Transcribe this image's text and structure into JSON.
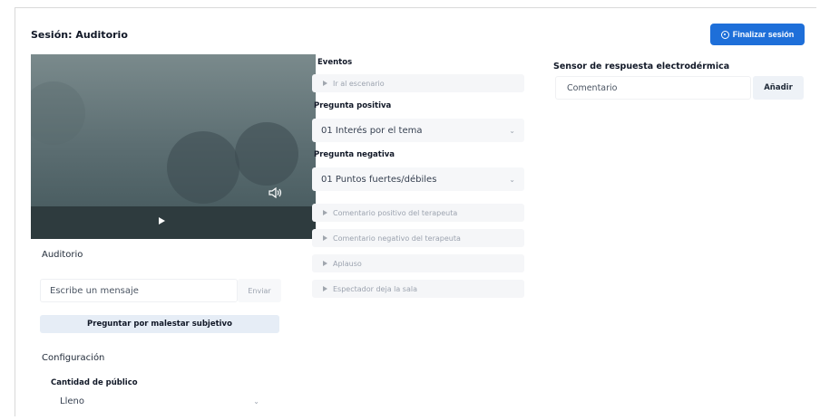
{
  "session": {
    "title": "Sesión: Auditorio",
    "finish_label": "Finalizar sesión"
  },
  "video": {
    "play_icon": "play-icon",
    "volume_icon": "volume-icon"
  },
  "audience": {
    "heading": "Auditorio",
    "message_placeholder": "Escribe un mensaje",
    "send_label": "Enviar",
    "ask_label": "Preguntar por malestar subjetivo"
  },
  "config": {
    "heading": "Configuración",
    "audience_amount_label": "Cantidad de público",
    "audience_amount_value": "Lleno"
  },
  "events": {
    "heading": "Eventos",
    "go_to_stage": "Ir al escenario",
    "positive_label": "Pregunta positiva",
    "positive_value": "01 Interés por el tema",
    "negative_label": "Pregunta negativa",
    "negative_value": "01 Puntos fuertes/débiles",
    "items": [
      "Comentario positivo del terapeuta",
      "Comentario negativo del terapeuta",
      "Aplauso",
      "Espectador deja la sala"
    ]
  },
  "sensor": {
    "heading": "Sensor de respuesta electrodérmica",
    "comment_placeholder": "Comentario",
    "add_label": "Añadir"
  }
}
